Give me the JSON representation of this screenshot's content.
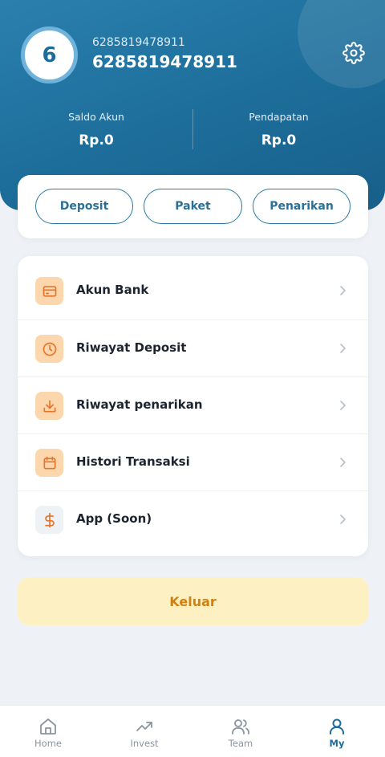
{
  "profile": {
    "avatar_text": "6",
    "phone_small": "6285819478911",
    "phone_big": "6285819478911"
  },
  "stats": {
    "balance_label": "Saldo Akun",
    "balance_value": "Rp.0",
    "income_label": "Pendapatan",
    "income_value": "Rp.0"
  },
  "actions": {
    "deposit": "Deposit",
    "paket": "Paket",
    "penarikan": "Penarikan"
  },
  "menu": {
    "items": [
      {
        "label": "Akun Bank",
        "icon": "credit-card-icon"
      },
      {
        "label": "Riwayat Deposit",
        "icon": "clock-icon"
      },
      {
        "label": "Riwayat penarikan",
        "icon": "download-icon"
      },
      {
        "label": "Histori Transaksi",
        "icon": "calendar-icon"
      },
      {
        "label": "App (Soon)",
        "icon": "dollar-icon"
      }
    ]
  },
  "logout_label": "Keluar",
  "tabbar": {
    "items": [
      {
        "label": "Home",
        "icon": "home-icon"
      },
      {
        "label": "Invest",
        "icon": "trending-up-icon"
      },
      {
        "label": "Team",
        "icon": "users-icon"
      },
      {
        "label": "My",
        "icon": "user-icon"
      }
    ],
    "active": "My"
  },
  "colors": {
    "primary": "#1e6c9c",
    "accent_orange": "#e8742a",
    "icon_bg": "#fcd7ad",
    "logout_bg": "#fdf1c4",
    "logout_text": "#d4800f"
  }
}
